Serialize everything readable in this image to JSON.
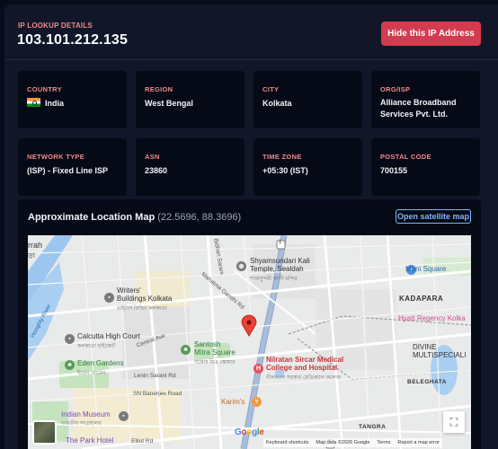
{
  "header": {
    "label": "IP LOOKUP DETAILS",
    "ip": "103.101.212.135",
    "hide_button": "Hide this IP Address"
  },
  "cards": [
    {
      "label": "COUNTRY",
      "value": "India",
      "icon": "india-flag"
    },
    {
      "label": "REGION",
      "value": "West Bengal"
    },
    {
      "label": "CITY",
      "value": "Kolkata"
    },
    {
      "label": "ORG/ISP",
      "value": "Alliance Broadband Services Pvt. Ltd."
    },
    {
      "label": "NETWORK TYPE",
      "value": "(ISP) - Fixed Line ISP"
    },
    {
      "label": "ASN",
      "value": "23860"
    },
    {
      "label": "TIME ZONE",
      "value": "+05:30 (IST)"
    },
    {
      "label": "POSTAL CODE",
      "value": "700155"
    }
  ],
  "map": {
    "title": "Approximate Location Map",
    "coords": "(22.5696, 88.3696)",
    "satellite_link": "Open satellite map",
    "labels": {
      "rah": "rrah",
      "rah_bn": "ড়া",
      "hooghly": "Hooghly River",
      "writers": "Writers'",
      "writers2": "Buildings Kolkata",
      "writers_bn": "রাইটার্স বিল্ডিং কলকাতা",
      "shyam": "Shyamsundari Kali",
      "shyam2": "Temple, Sealdah",
      "shyam_bn": "শ্যামসুন্দরী কালী মন্দির",
      "high_court": "Calcutta High Court",
      "high_court_bn": "কলকাতা হাইকোর্ট",
      "santosh": "Santosh",
      "santosh2": "Mitra Square",
      "santosh_bn": "সন্তোষ মিত্র স্কোয়ার",
      "eden": "Eden Gardens",
      "eden_bn": "ইডেন গার্ডেন",
      "nilratan": "Nilratan Sircar Medical",
      "nilratan2": "College and Hospital",
      "nilratan_bn": "নীলরতন সরকার মেডিক্যাল কলেজ",
      "indian_museum": "Indian Museum",
      "indian_museum_bn": "ভারতীয় সংগ্রহালয়",
      "park_hotel": "The Park Hotel",
      "karims": "Karim's",
      "mani": "Mani Square",
      "kadapara": "KADAPARA",
      "hyatt": "Hyatt Regency Kolka",
      "divine": "DIVINE",
      "divine2": "MULTISPECIALI",
      "beleghata": "BELEGHATA",
      "tangra": "TANGRA",
      "road_bidhan": "Bidhan Sarani",
      "road_mg": "Mahatma Gandhi Rd",
      "road_central": "Central Ave",
      "road_lenin": "Lenin Sarani Rd",
      "road_banerjee": "SN Banerjee Road",
      "road_elliot": "Elliot Rd",
      "route_1": "1",
      "route_2": "1"
    },
    "footer": {
      "shortcuts": "Keyboard shortcuts",
      "mapdata": "Map data ©2026 Google",
      "terms": "Terms",
      "report": "Report a map error"
    },
    "google": "Google"
  },
  "colors": {
    "accent_red": "#d33b4e",
    "label_pink": "#f08a8a",
    "link_blue": "#7fb4ff",
    "marker_red": "#ea4335"
  }
}
